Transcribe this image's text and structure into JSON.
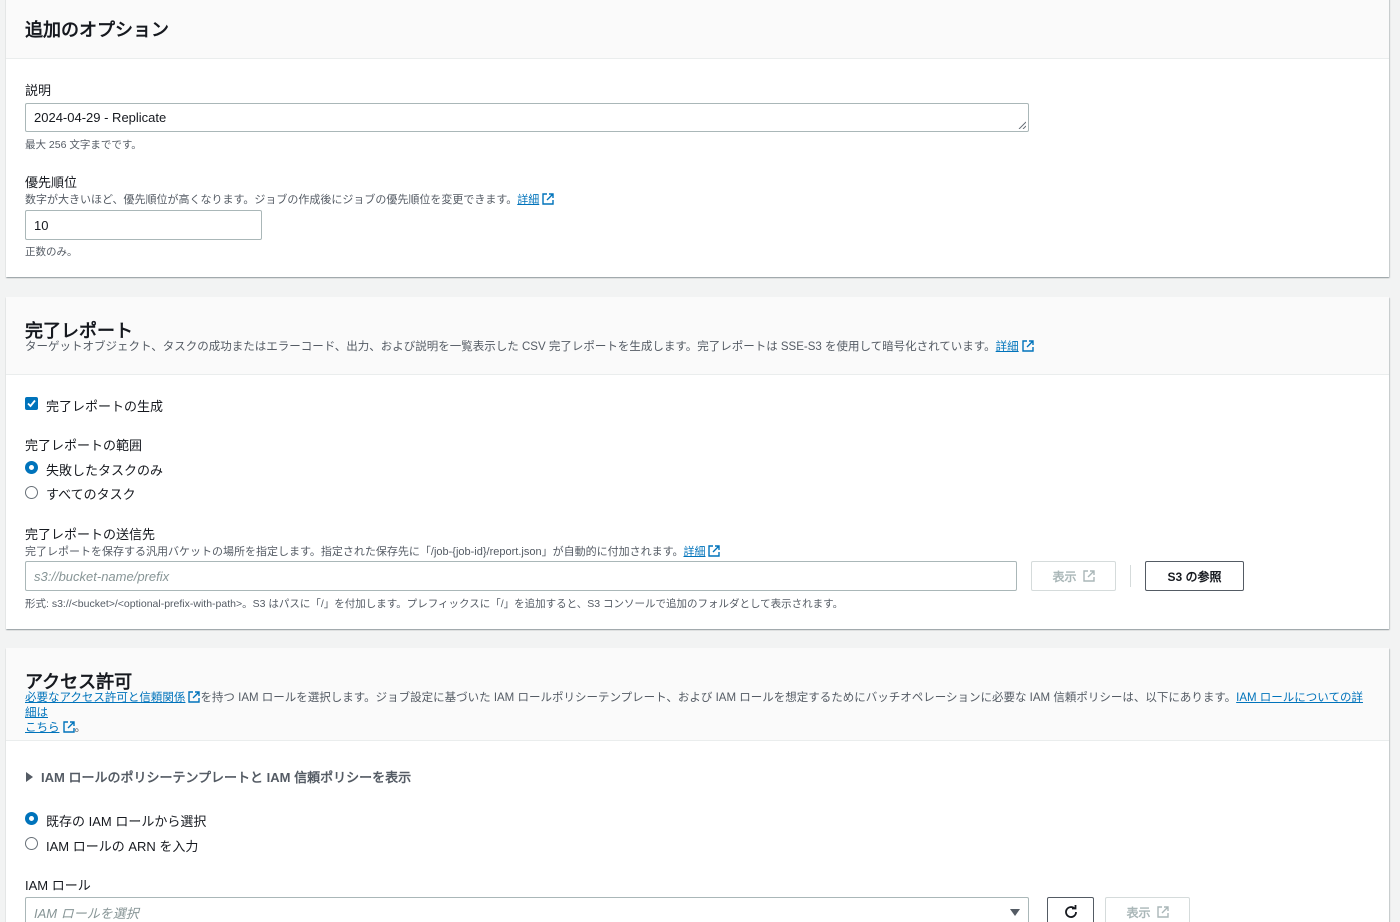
{
  "options": {
    "title": "追加のオプション",
    "description_label": "説明",
    "description_value": "2024-04-29 - Replicate",
    "description_hint": "最大 256 文字までです。",
    "priority_label": "優先順位",
    "priority_desc": "数字が大きいほど、優先順位が高くなります。ジョブの作成後にジョブの優先順位を変更できます。",
    "priority_link": "詳細",
    "priority_value": "10",
    "priority_hint": "正数のみ。"
  },
  "report": {
    "title": "完了レポート",
    "desc": "ターゲットオブジェクト、タスクの成功またはエラーコード、出力、および説明を一覧表示した CSV 完了レポートを生成します。完了レポートは SSE-S3 を使用して暗号化されています。",
    "desc_link": "詳細",
    "generate_label": "完了レポートの生成",
    "scope_label": "完了レポートの範囲",
    "scope_failed": "失敗したタスクのみ",
    "scope_all": "すべてのタスク",
    "dest_label": "完了レポートの送信先",
    "dest_desc": "完了レポートを保存する汎用バケットの場所を指定します。指定された保存先に「/job-{job-id}/report.json」が自動的に付加されます。",
    "dest_link": "詳細",
    "dest_placeholder": "s3://bucket-name/prefix",
    "view_button": "表示",
    "browse_button": "S3 の参照",
    "format_hint": "形式: s3://<bucket>/<optional-prefix-with-path>。S3 はパスに「/」を付加します。プレフィックスに「/」を追加すると、S3 コンソールで追加のフォルダとして表示されます。"
  },
  "access": {
    "title": "アクセス許可",
    "desc_link1": "必要なアクセス許可と信頼関係",
    "desc_mid": "を持つ IAM ロールを選択します。ジョブ設定に基づいた IAM ロールポリシーテンプレート、および IAM ロールを想定するためにバッチオペレーションに必要な IAM 信頼ポリシーは、以下にあります。",
    "desc_link2": "IAM ロールについての詳細は",
    "desc_link2b": "こちら",
    "desc_end": "。",
    "expander": "IAM ロールのポリシーテンプレートと IAM 信頼ポリシーを表示",
    "opt_existing": "既存の IAM ロールから選択",
    "opt_arn": "IAM ロールの ARN を入力",
    "role_label": "IAM ロール",
    "role_placeholder": "IAM ロールを選択",
    "view_button": "表示"
  },
  "colors": {
    "link": "#0073bb",
    "accent": "#0073bb"
  }
}
